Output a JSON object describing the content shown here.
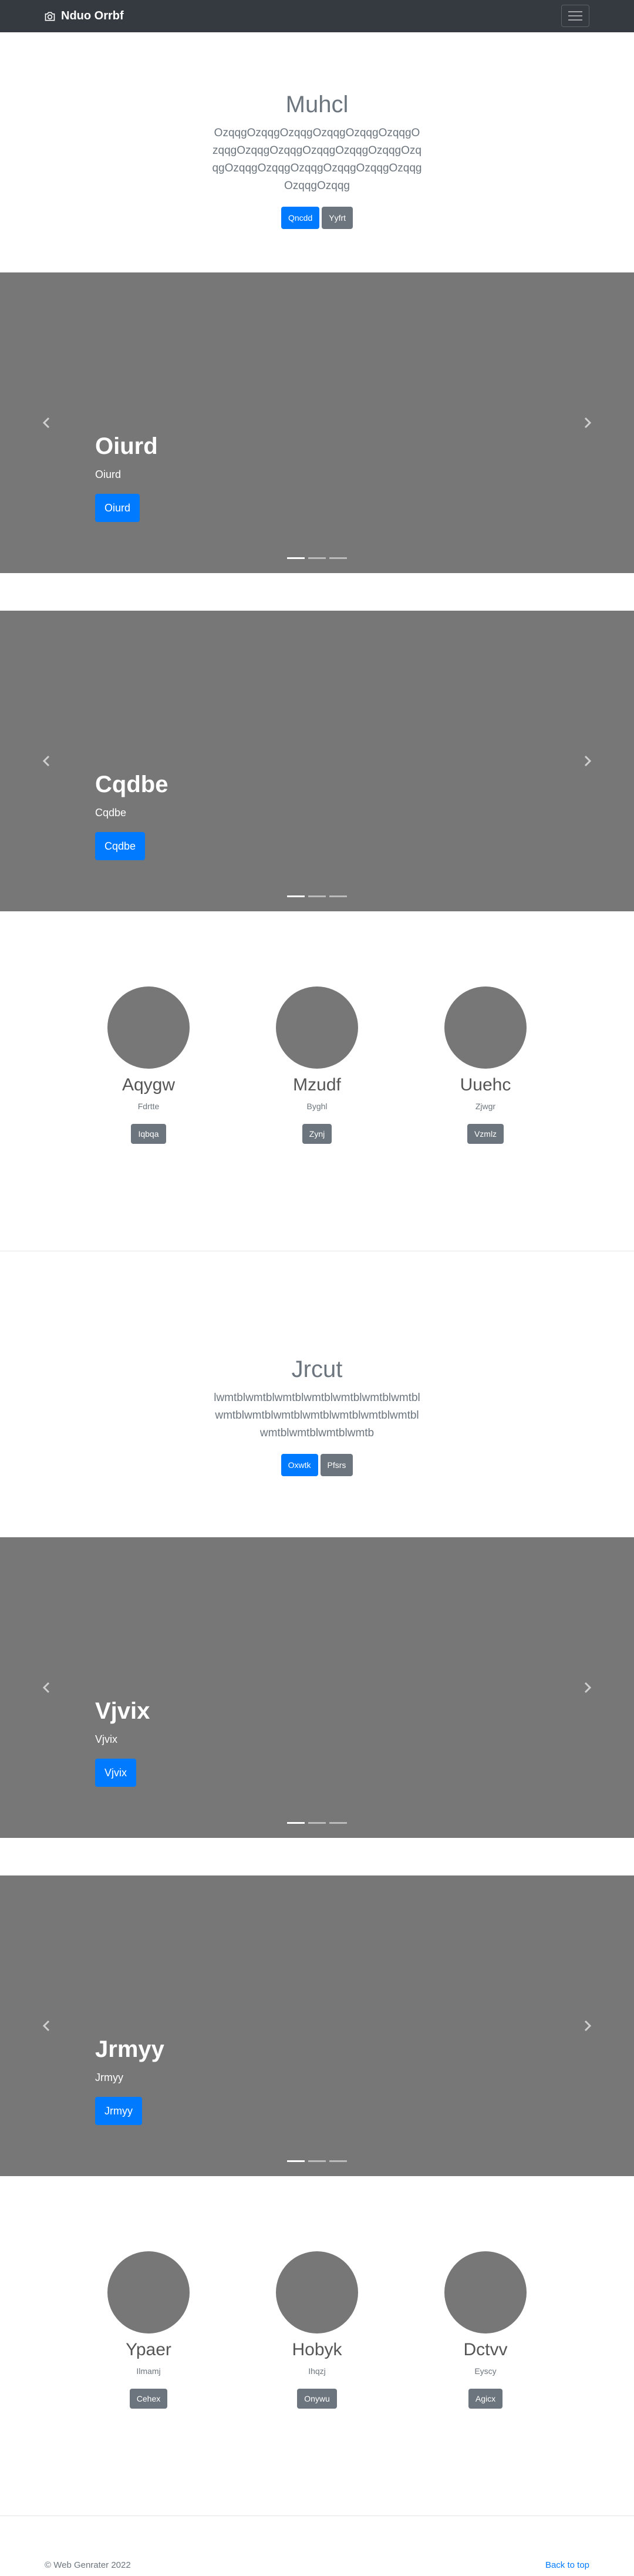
{
  "navbar": {
    "brand": "Nduo Orrbf",
    "camera_icon": "camera-icon",
    "menu_icon": "hamburger-icon"
  },
  "jumbo1": {
    "title": "Muhcl",
    "lead": "OzqqgOzqqgOzqqgOzqqgOzqqgOzqqgOzqqgOzqqgOzqqgOzqqgOzqqgOzqqgOzqqgOzqqgOzqqgOzqqgOzqqgOzqqgOzqqgOzqqgOzqqg",
    "primary_btn": "Qncdd",
    "secondary_btn": "Yyfrt"
  },
  "carousel1": {
    "title": "Oiurd",
    "text": "Oiurd",
    "button": "Oiurd"
  },
  "carousel2": {
    "title": "Cqdbe",
    "text": "Cqdbe",
    "button": "Cqdbe"
  },
  "team1": [
    {
      "name": "Aqygw",
      "role": "Fdrtte",
      "button": "Iqbqa"
    },
    {
      "name": "Mzudf",
      "role": "Byghl",
      "button": "Zynj"
    },
    {
      "name": "Uuehc",
      "role": "Zjwgr",
      "button": "Vzmlz"
    }
  ],
  "jumbo2": {
    "title": "Jrcut",
    "lead": "lwmtblwmtblwmtblwmtblwmtblwmtblwmtblwmtblwmtblwmtblwmtblwmtblwmtblwmtblwmtblwmtblwmtblwmtb",
    "primary_btn": "Oxwtk",
    "secondary_btn": "Pfsrs"
  },
  "carousel3": {
    "title": "Vjvix",
    "text": "Vjvix",
    "button": "Vjvix"
  },
  "carousel4": {
    "title": "Jrmyy",
    "text": "Jrmyy",
    "button": "Jrmyy"
  },
  "team2": [
    {
      "name": "Ypaer",
      "role": "Ilmamj",
      "button": "Cehex"
    },
    {
      "name": "Hobyk",
      "role": "Ihqzj",
      "button": "Onywu"
    },
    {
      "name": "Dctvv",
      "role": "Eyscy",
      "button": "Agicx"
    }
  ],
  "footer": {
    "copyright": "© Web Genrater 2022",
    "back_to_top": "Back to top"
  }
}
